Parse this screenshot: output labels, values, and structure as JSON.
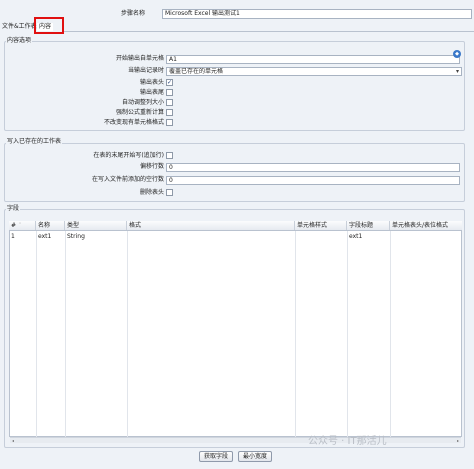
{
  "step_name": {
    "label": "步骤名称",
    "value": "Microsoft Excel 输出测试1"
  },
  "tabs": [
    {
      "label": "文件&工作表"
    },
    {
      "label": "内容"
    }
  ],
  "content_options": {
    "title": "内容选项",
    "start_cell": {
      "label": "开始输出自单元格",
      "value": "A1"
    },
    "when_output": {
      "label": "当输出记录时",
      "value": "覆盖已存在的单元格"
    },
    "write_header": {
      "label": "输出表头",
      "checked": true
    },
    "write_footer": {
      "label": "输出表尾",
      "checked": false
    },
    "auto_size_columns": {
      "label": "自动调整列大小",
      "checked": false
    },
    "force_formula_recalc": {
      "label": "强制公式重新计算",
      "checked": false
    },
    "leave_styles_unchanged": {
      "label": "不改变现有单元格格式",
      "checked": false
    }
  },
  "existing_sheet": {
    "title": "写入已存在的工作表",
    "start_at_end": {
      "label": "在表的末尾开始写(追加行)",
      "checked": false
    },
    "offset_rows": {
      "label": "偏移行数",
      "value": "0"
    },
    "blank_rows_before": {
      "label": "在写入文件前添加的空行数",
      "value": "0"
    },
    "omit_header": {
      "label": "删除表头",
      "checked": false
    }
  },
  "fields": {
    "title": "字段",
    "columns": [
      "#",
      "名称",
      "类型",
      "格式",
      "单元格样式",
      "字段标题",
      "单元格表头/表位格式"
    ],
    "rows": [
      {
        "num": "1",
        "name": "ext1",
        "type": "String",
        "format": "",
        "style": "",
        "title": "ext1",
        "header_format": ""
      }
    ]
  },
  "buttons": {
    "get_fields": "获取字段",
    "min_width": "最小宽度"
  },
  "watermark": "公众号 · IT那活儿",
  "colors": {
    "highlight_border": "#e01010",
    "checkmark": "#1f3d7a"
  }
}
